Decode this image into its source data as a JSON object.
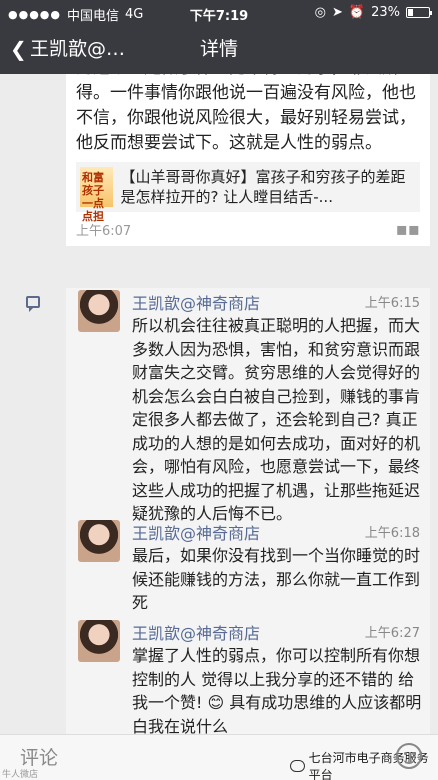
{
  "status_bar": {
    "carrier": "中国电信",
    "network": "4G",
    "time": "下午7:19",
    "battery": "23%",
    "battery_level": 0.23
  },
  "nav": {
    "back_title": "王凯歆@…",
    "title": "详情"
  },
  "post": {
    "text": "的这个人是做了什么见不得人的事，非法所得。一件事情你跟他说一百遍没有风险，他也不信，你跟他说风险很大，最好别轻易尝试，他反而想要尝试下。这就是人性的弱点。",
    "link_thumb_text": "和富孩子一点点担",
    "link_title": "【山羊哥哥你真好】富孩子和穷孩子的差距是怎样拉开的? 让人瞠目结舌-...",
    "time": "上午6:07"
  },
  "comments": [
    {
      "name": "王凯歆@神奇商店",
      "time": "上午6:15",
      "text": "所以机会往往被真正聪明的人把握，而大多数人因为恐惧，害怕，和贫穷意识而跟财富失之交臂。贫穷思维的人会觉得好的机会怎么会白白被自己捡到，赚钱的事肯定很多人都去做了，还会轮到自己? 真正成功的人想的是如何去成功，面对好的机会，哪怕有风险，也愿意尝试一下，最终这些人成功的把握了机遇，让那些拖延迟疑犹豫的人后悔不已。"
    },
    {
      "name": "王凯歆@神奇商店",
      "time": "上午6:18",
      "text": "最后，如果你没有找到一个当你睡觉的时候还能赚钱的方法，那么你就一直工作到死"
    },
    {
      "name": "王凯歆@神奇商店",
      "time": "上午6:27",
      "text": "掌握了人性的弱点，你可以控制所有你想控制的人 觉得以上我分享的还不错的 给我一个赞! 😊 具有成功思维的人应该都明白我在说什么"
    }
  ],
  "bottom": {
    "comment_label": "评论",
    "watermark": "七台河市电子商务服务平台",
    "corner_logo": "牛人微店"
  }
}
